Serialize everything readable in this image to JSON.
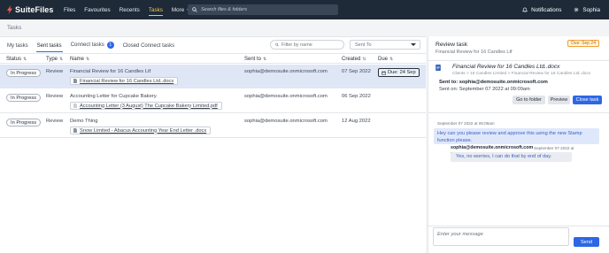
{
  "app": {
    "brand": "SuiteFiles"
  },
  "nav": {
    "items": [
      {
        "label": "Files",
        "active": false
      },
      {
        "label": "Favourites",
        "active": false
      },
      {
        "label": "Recents",
        "active": false
      },
      {
        "label": "Tasks",
        "active": true
      },
      {
        "label": "More",
        "active": false
      }
    ]
  },
  "search": {
    "placeholder": "Search files & folders"
  },
  "topright": {
    "notifications": "Notifications",
    "user": "Sophia"
  },
  "breadcrumb": "Tasks",
  "tasks": {
    "tabs": [
      {
        "label": "My tasks",
        "active": false
      },
      {
        "label": "Sent tasks",
        "active": true
      },
      {
        "label": "Connect tasks",
        "active": false,
        "badge": "1"
      },
      {
        "label": "Closed Connect tasks",
        "active": false
      }
    ],
    "filter_placeholder": "Filter by name",
    "sent_to_select": "Sent To",
    "columns": {
      "status": "Status",
      "type": "Type",
      "name": "Name",
      "sent_to": "Sent to",
      "created": "Created",
      "due": "Due"
    },
    "rows": [
      {
        "status": "In Progress",
        "type": "Review",
        "name": "Financial Review for 16 Candles Ltf",
        "file": "Financial Review for 16 Candles Ltd..docx",
        "sent_to": "sophia@demosuite.onmicrosoft.com",
        "created": "07 Sep 2022",
        "due": "Due: 24 Sep",
        "selected": true
      },
      {
        "status": "In Progress",
        "type": "Review",
        "name": "Accounting Letter for Cupcake Bakery.",
        "file": "Accounting Letter (3 August) The Cupcake Bakery Limited.pdf",
        "sent_to": "sophia@demosuite.onmicrosoft.com",
        "created": "06 Sep 2022",
        "due": "",
        "selected": false
      },
      {
        "status": "In Progress",
        "type": "Review",
        "name": "Demo Thing",
        "file": "Snow Limited - Abacus Accounting Year End Letter .docx",
        "sent_to": "sophia@demosuite.onmicrosoft.com",
        "created": "12 Aug 2022",
        "due": "",
        "selected": false
      }
    ]
  },
  "review": {
    "title": "Review task",
    "subtitle": "Financial Review for 16 Candles Ltf",
    "due_tag": "Due: Sep 24",
    "file_name": "Financial Review for 16 Candles Ltd..docx",
    "file_path": "Clients > 16 Candles Limited > Financial Review for 16 Candles Ltd..docx",
    "sent_to": "Sent to: sophia@demosuite.onmicrosoft.com",
    "sent_on": "Sent on: September 07 2022 at 09:09am",
    "buttons": {
      "go_to_folder": "Go to folder",
      "preview": "Preview",
      "close_task": "Close task"
    }
  },
  "messages": [
    {
      "time": "September 07 2022 at 09:09am",
      "text": "Hey can you please review and approve this using the new Stamp function please."
    },
    {
      "sender": "sophia@demosuite.onmicrosoft.com",
      "time": "September 07 2022 at",
      "mini": "09:08",
      "text": "Yes, no worries, I can do that by end of day."
    }
  ],
  "compose": {
    "placeholder": "Enter your message",
    "send_label": "Send"
  },
  "colors": {
    "topbar": "#1e2a38",
    "accent": "#2d67e5",
    "active_nav": "#f2c94c",
    "due_tag": "#f0a030"
  }
}
